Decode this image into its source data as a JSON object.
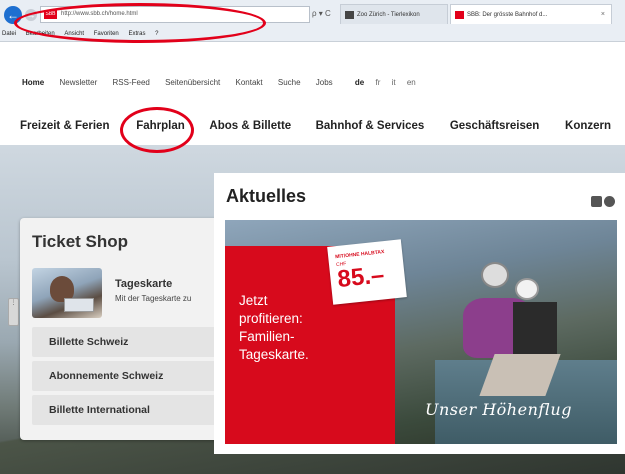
{
  "browser": {
    "address": "http://www.sbb.ch/home.html",
    "address_favicon": "SBB",
    "address_tools": "ρ ▾ C",
    "tabs": [
      {
        "label": "Zoo Zürich - Tierlexikon"
      },
      {
        "label": "SBB: Der grösste Bahnhof d...",
        "close": "×"
      }
    ],
    "menu": [
      "Datei",
      "Bearbeiten",
      "Ansicht",
      "Favoriten",
      "Extras",
      "?"
    ]
  },
  "service_nav": {
    "items": [
      "Home",
      "Newsletter",
      "RSS-Feed",
      "Seitenübersicht",
      "Kontakt",
      "Suche",
      "Jobs"
    ],
    "languages": [
      "de",
      "fr",
      "it",
      "en"
    ],
    "active_language": "de"
  },
  "main_nav": {
    "items": [
      "Freizeit & Ferien",
      "Fahrplan",
      "Abos & Billette",
      "Bahnhof & Services",
      "Geschäftsreisen",
      "Konzern"
    ]
  },
  "ticket_shop": {
    "title": "Ticket Shop",
    "card": {
      "title": "Tageskarte",
      "desc": "Mit der Tageskarte zu"
    },
    "links": [
      "Billette Schweiz",
      "Abonnemente Schweiz",
      "Billette International"
    ]
  },
  "aktuelles": {
    "title": "Aktuelles",
    "ad": {
      "text": "Jetzt\nprofitieren:\nFamilien-\nTageskarte.",
      "price_label": "MIT/OHNE HALBTAX",
      "currency": "CHF",
      "price": "85.–",
      "slogan": "Unser Höhenflug"
    }
  },
  "colors": {
    "brand_red": "#d70a1c",
    "annotation_red": "#e2001a"
  },
  "icons": [
    "back-arrow-icon",
    "forward-arrow-icon",
    "search-icon",
    "refresh-icon",
    "email-icon",
    "share-icon"
  ]
}
